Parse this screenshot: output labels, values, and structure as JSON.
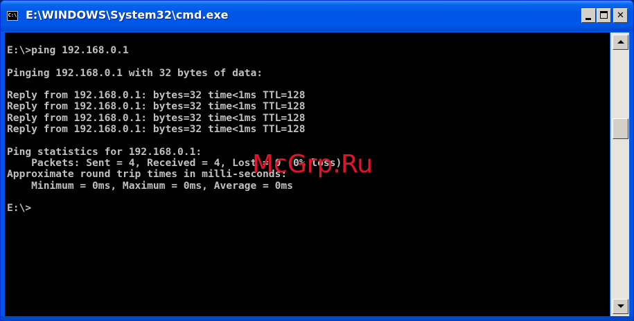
{
  "window": {
    "title": "E:\\WINDOWS\\System32\\cmd.exe",
    "icon_label": "C:\\",
    "minimize_icon": "minimize-icon",
    "maximize_icon": "maximize-icon",
    "close_label": "✕"
  },
  "console": {
    "output": "E:\\>ping 192.168.0.1\n\nPinging 192.168.0.1 with 32 bytes of data:\n\nReply from 192.168.0.1: bytes=32 time<1ms TTL=128\nReply from 192.168.0.1: bytes=32 time<1ms TTL=128\nReply from 192.168.0.1: bytes=32 time<1ms TTL=128\nReply from 192.168.0.1: bytes=32 time<1ms TTL=128\n\nPing statistics for 192.168.0.1:\n    Packets: Sent = 4, Received = 4, Lost = 0 (0% loss),\nApproximate round trip times in milli-seconds:\n    Minimum = 0ms, Maximum = 0ms, Average = 0ms\n\nE:\\>"
  },
  "watermark": {
    "text": "McGrp.Ru"
  },
  "scrollbar": {
    "position_fraction": 0.3
  },
  "colors": {
    "titlebar": "#0055e5",
    "console_bg": "#000000",
    "console_text": "#c0c0c0",
    "watermark": "#e2142c"
  }
}
